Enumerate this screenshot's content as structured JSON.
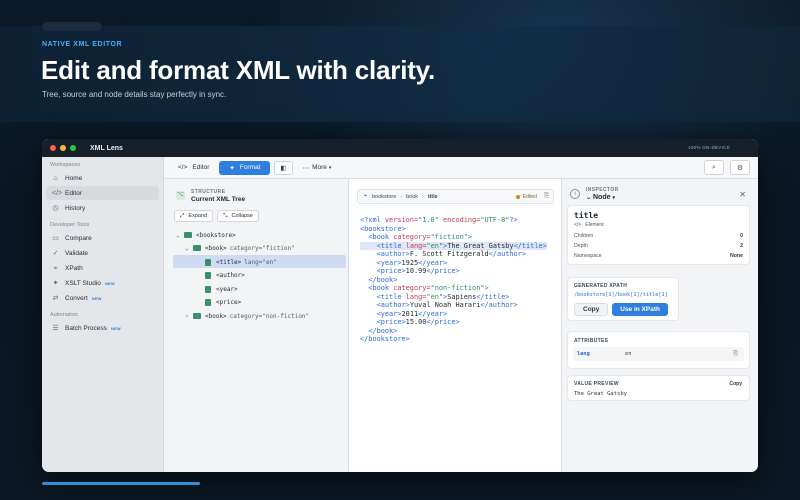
{
  "hero": {
    "eyebrow": "NATIVE XML EDITOR",
    "headline": "Edit and format XML with clarity.",
    "subline": "Tree, source and node details stay perfectly in sync."
  },
  "window": {
    "title": "XML Lens",
    "status": "100% ON-DEVICE"
  },
  "sidebar": {
    "groups": [
      {
        "heading": "Workspaces",
        "items": [
          {
            "label": "Home"
          },
          {
            "label": "Editor"
          },
          {
            "label": "History"
          }
        ]
      },
      {
        "heading": "Developer Tools",
        "items": [
          {
            "label": "Compare"
          },
          {
            "label": "Validate"
          },
          {
            "label": "XPath"
          },
          {
            "label": "XSLT Studio",
            "badge": "NEW"
          },
          {
            "label": "Convert",
            "badge": "NEW"
          }
        ]
      },
      {
        "heading": "Automation",
        "items": [
          {
            "label": "Batch Process",
            "badge": "NEW"
          }
        ]
      }
    ]
  },
  "toolbar": {
    "editor": "Editor",
    "format": "Format",
    "more": "More"
  },
  "tree": {
    "structure_label": "STRUCTURE",
    "structure_title": "Current XML Tree",
    "expand": "Expand",
    "collapse": "Collapse",
    "nodes": [
      {
        "label": "<bookstore>",
        "attr": ""
      },
      {
        "label": "<book>",
        "attr": "category=\"fiction\""
      },
      {
        "label": "<title>",
        "attr": "lang=\"en\""
      },
      {
        "label": "<author>",
        "attr": ""
      },
      {
        "label": "<year>",
        "attr": ""
      },
      {
        "label": "<price>",
        "attr": ""
      },
      {
        "label": "<book>",
        "attr": "category=\"non-fiction\""
      }
    ]
  },
  "editor": {
    "crumbs": [
      "bookstore",
      "book",
      "title"
    ],
    "edited": "Edited",
    "lines": [
      "<?xml version=\"1.0\" encoding=\"UTF-8\"?>",
      "<bookstore>",
      "  <book category=\"fiction\">",
      "    <title lang=\"en\">The Great Gatsby</title>",
      "    <author>F. Scott Fitzgerald</author>",
      "    <year>1925</year>",
      "    <price>10.99</price>",
      "  </book>",
      "  <book category=\"non-fiction\">",
      "    <title lang=\"en\">Sapiens</title>",
      "    <author>Yuval Noah Harari</author>",
      "    <year>2011</year>",
      "    <price>15.00</price>",
      "  </book>",
      "</bookstore>"
    ]
  },
  "inspector": {
    "label": "INSPECTOR",
    "node": "Node",
    "element_name": "title",
    "element_label": "Element",
    "rows": [
      {
        "k": "Children",
        "v": "0"
      },
      {
        "k": "Depth",
        "v": "2"
      },
      {
        "k": "Namespace",
        "v": "None"
      }
    ],
    "xpath_label": "GENERATED XPATH",
    "xpath": "/bookstore[1]/book[1]/title[1]",
    "copy": "Copy",
    "use_xpath": "Use in XPath",
    "attributes_label": "ATTRIBUTES",
    "attr_key": "lang",
    "attr_val": "en",
    "preview_label": "VALUE PREVIEW",
    "preview_copy": "Copy",
    "preview": "The Great Gatsby"
  }
}
